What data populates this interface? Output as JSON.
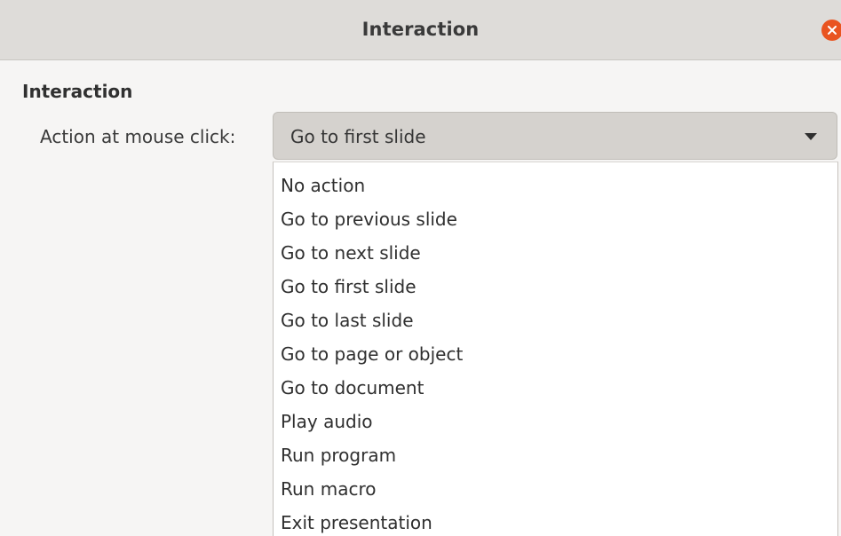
{
  "dialog": {
    "title": "Interaction"
  },
  "section": {
    "heading": "Interaction"
  },
  "action_field": {
    "label": "Action at mouse click:",
    "selected": "Go to first slide"
  },
  "dropdown": {
    "options": [
      "No action",
      "Go to previous slide",
      "Go to next slide",
      "Go to first slide",
      "Go to last slide",
      "Go to page or object",
      "Go to document",
      "Play audio",
      "Run program",
      "Run macro",
      "Exit presentation"
    ]
  },
  "icons": {
    "close": "close-icon",
    "dropdown_arrow": "chevron-down-icon"
  },
  "colors": {
    "close_button": "#e95420",
    "titlebar": "#dedcd9",
    "combo_background": "#d5d2ce"
  }
}
